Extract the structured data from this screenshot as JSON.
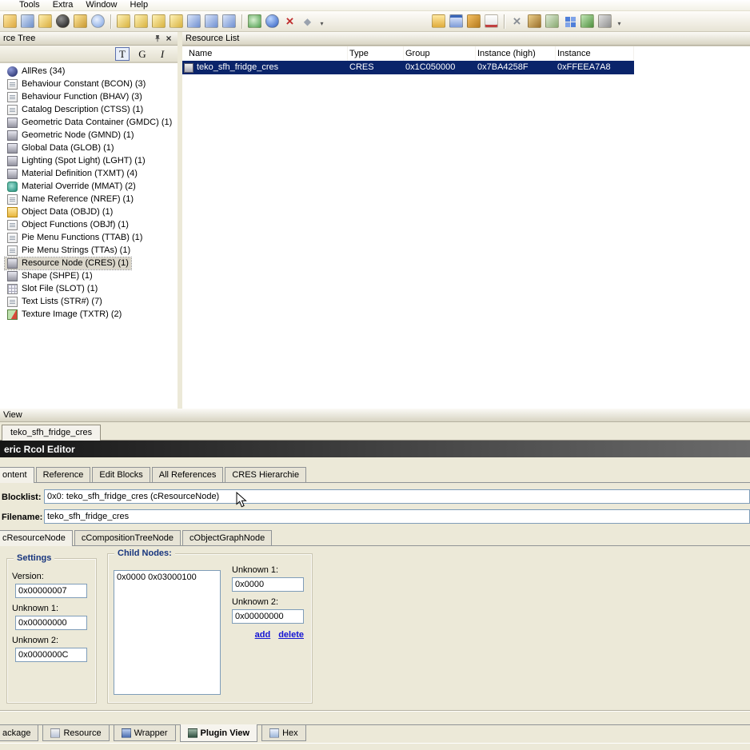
{
  "colors": {
    "selection_bg": "#0a246a",
    "link_blue": "#1414d4",
    "groupbox_title": "#17357e"
  },
  "menu": {
    "items": [
      "Tools",
      "Extra",
      "Window",
      "Help"
    ]
  },
  "toolbar": {
    "icons": [
      "open",
      "save",
      "save-all",
      "close-package",
      "export",
      "search",
      "new-resource",
      "add-resource",
      "save-resource",
      "copy-resource",
      "window-list",
      "window-details",
      "window-preview",
      "refresh",
      "web",
      "delete",
      "diamond",
      "overflow",
      "folder",
      "preview-window",
      "package-box",
      "notes",
      "cut",
      "people",
      "photo",
      "grid",
      "users",
      "tools",
      "overflow-2"
    ]
  },
  "tree_panel": {
    "title": "rce Tree",
    "buttons": [
      "T",
      "G",
      "I"
    ],
    "items": [
      {
        "label": "AllRes (34)",
        "icon": "sphere"
      },
      {
        "label": "Behaviour Constant (BCON) (3)",
        "icon": "document"
      },
      {
        "label": "Behaviour Function (BHAV) (3)",
        "icon": "document"
      },
      {
        "label": "Catalog Description (CTSS) (1)",
        "icon": "document"
      },
      {
        "label": "Geometric Data Container (GMDC) (1)",
        "icon": "database"
      },
      {
        "label": "Geometric Node (GMND) (1)",
        "icon": "database"
      },
      {
        "label": "Global Data (GLOB) (1)",
        "icon": "database"
      },
      {
        "label": "Lighting (Spot Light) (LGHT) (1)",
        "icon": "database"
      },
      {
        "label": "Material Definition (TXMT) (4)",
        "icon": "database"
      },
      {
        "label": "Material Override (MMAT) (2)",
        "icon": "material"
      },
      {
        "label": "Name Reference (NREF) (1)",
        "icon": "document"
      },
      {
        "label": "Object Data (OBJD) (1)",
        "icon": "folder"
      },
      {
        "label": "Object Functions (OBJf) (1)",
        "icon": "document"
      },
      {
        "label": "Pie Menu Functions (TTAB) (1)",
        "icon": "document"
      },
      {
        "label": "Pie Menu Strings (TTAs) (1)",
        "icon": "document"
      },
      {
        "label": "Resource Node (CRES) (1)",
        "icon": "database",
        "selected": true
      },
      {
        "label": "Shape (SHPE) (1)",
        "icon": "database"
      },
      {
        "label": "Slot File (SLOT) (1)",
        "icon": "grid"
      },
      {
        "label": "Text Lists (STR#) (7)",
        "icon": "document"
      },
      {
        "label": "Texture Image (TXTR) (2)",
        "icon": "image"
      }
    ]
  },
  "list_panel": {
    "title": "Resource List",
    "columns": [
      "Name",
      "Type",
      "Group",
      "Instance (high)",
      "Instance"
    ],
    "rows": [
      {
        "name": "teko_sfh_fridge_cres",
        "type": "CRES",
        "group": "0x1C050000",
        "instance_high": "0x7BA4258F",
        "instance": "0xFFEEA7A8"
      }
    ]
  },
  "view_panel": {
    "title": "View",
    "tab": "teko_sfh_fridge_cres"
  },
  "editor": {
    "title": "eric Rcol Editor",
    "tabs": [
      "ontent",
      "Reference",
      "Edit Blocks",
      "All References",
      "CRES Hierarchie"
    ],
    "blocklist_label": "Blocklist:",
    "blocklist_value": "0x0: teko_sfh_fridge_cres (cResourceNode)",
    "filename_label": "Filename:",
    "filename_value": "teko_sfh_fridge_cres",
    "node_tabs": [
      "cResourceNode",
      "cCompositionTreeNode",
      "cObjectGraphNode"
    ],
    "settings": {
      "title": "Settings",
      "fields": [
        {
          "label": "Version:",
          "value": "0x00000007"
        },
        {
          "label": "Unknown 1:",
          "value": "0x00000000"
        },
        {
          "label": "Unknown 2:",
          "value": "0x0000000C"
        }
      ]
    },
    "child_nodes": {
      "title": "Child Nodes:",
      "list_items": [
        "0x0000 0x03000100"
      ],
      "fields": [
        {
          "label": "Unknown 1:",
          "value": "0x0000"
        },
        {
          "label": "Unknown 2:",
          "value": "0x00000000"
        }
      ],
      "links": [
        "add",
        "delete"
      ]
    }
  },
  "bottom_tabs": [
    {
      "label": "ackage"
    },
    {
      "label": "Resource"
    },
    {
      "label": "Wrapper"
    },
    {
      "label": "Plugin View",
      "active": true
    },
    {
      "label": "Hex"
    }
  ]
}
